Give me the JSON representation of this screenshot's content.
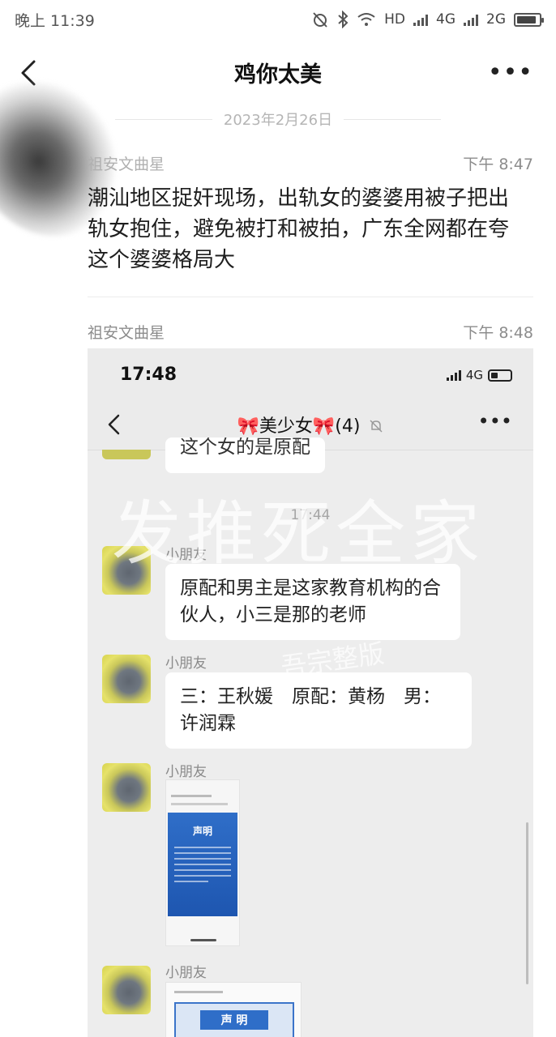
{
  "status_bar": {
    "time": "晚上 11:39",
    "network_hd": "HD",
    "network_4g": "4G",
    "network_2g": "2G",
    "battery_level": 0.9
  },
  "nav": {
    "title": "鸡你太美",
    "more": "•••"
  },
  "date_separator": "2023年2月26日",
  "posts": [
    {
      "sender": "祖安文曲星",
      "time": "下午 8:47",
      "text": "潮汕地区捉奸现场，出轨女的婆婆用被子把出轨女抱住，避免被打和被拍，广东全网都在夸这个婆婆格局大"
    },
    {
      "sender": "祖安文曲星",
      "time": "下午 8:48"
    }
  ],
  "screenshot": {
    "status_time": "17:48",
    "status_network": "4G",
    "battery_level": 0.35,
    "chat_title": "🎀美少女🎀(4)",
    "more": "•••",
    "watermark": "发推死全家",
    "watermark_small": "吾宗整版",
    "partial_message": "这个女的是原配",
    "chat_time": "17:44",
    "messages": [
      {
        "sender": "小朋友",
        "text": "原配和男主是这家教育机构的合伙人，小三是那的老师"
      },
      {
        "sender": "小朋友",
        "text": "三：王秋媛　原配：黄杨　男：许润霖"
      },
      {
        "sender": "小朋友",
        "image_title": "声明"
      },
      {
        "sender": "小朋友",
        "image_title": "声 明"
      }
    ]
  }
}
